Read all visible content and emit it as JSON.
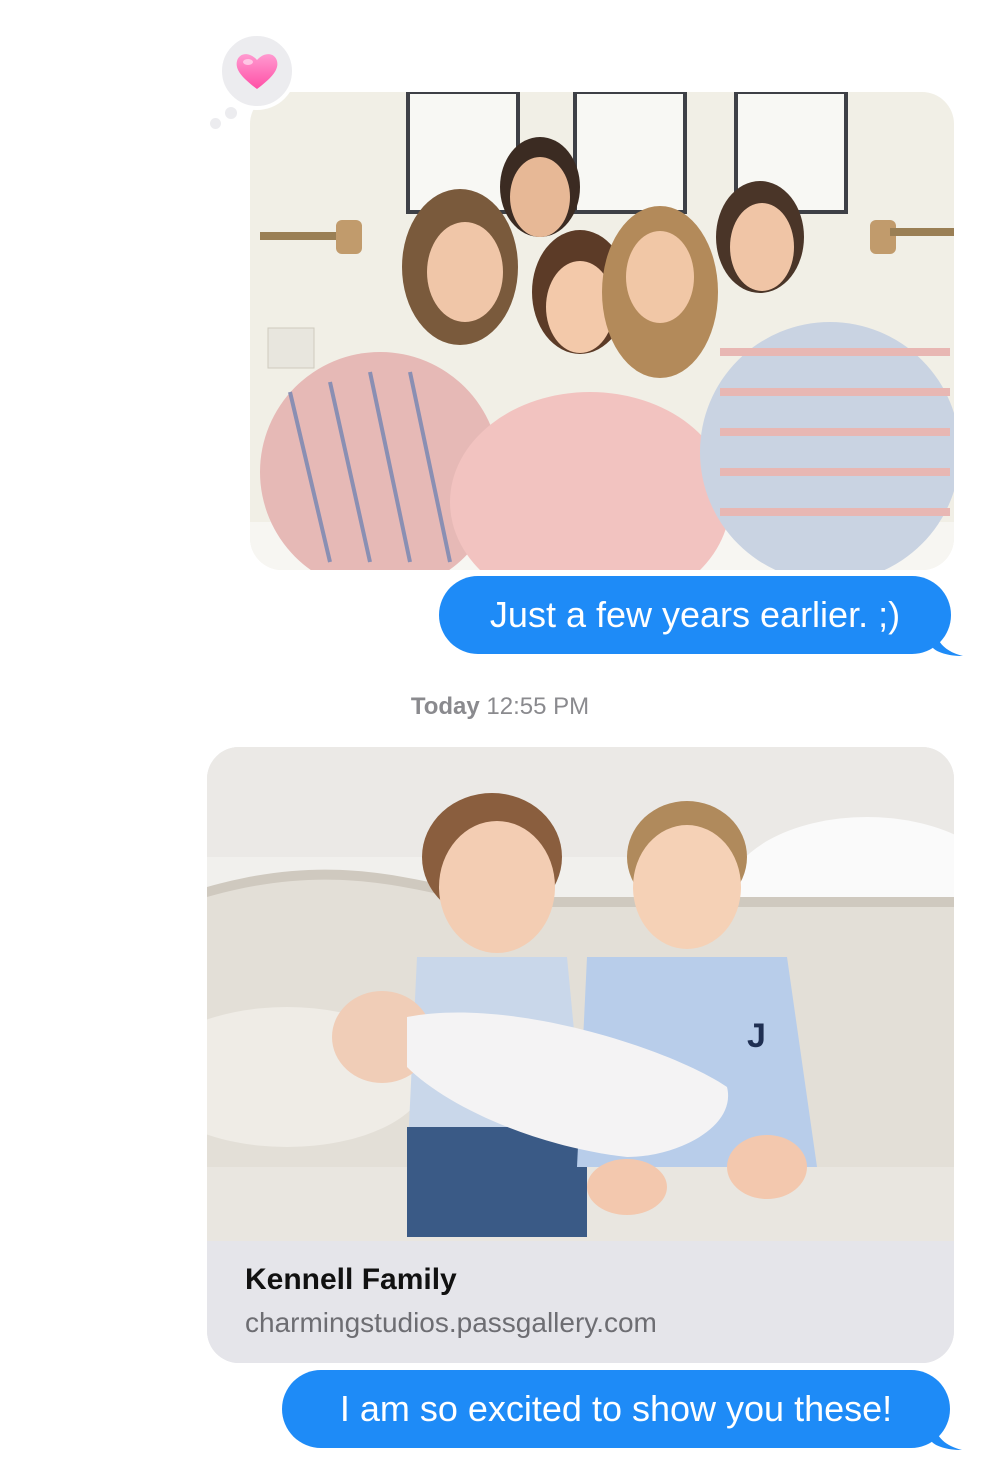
{
  "conversation": {
    "messages": [
      {
        "type": "photo",
        "photo_name": "group-photo",
        "reaction": "heart-icon"
      },
      {
        "type": "text",
        "text": "Just a few years earlier. ;)"
      },
      {
        "type": "timestamp",
        "day": "Today",
        "time": "12:55 PM"
      },
      {
        "type": "link-preview",
        "title": "Kennell Family",
        "url": "charmingstudios.passgallery.com"
      },
      {
        "type": "text",
        "text": "I am so excited to show you these!"
      }
    ]
  },
  "colors": {
    "bubble_blue": "#1e8bf7",
    "link_card_bg": "#e5e5ea",
    "timestamp_gray": "#8a8a8e"
  }
}
